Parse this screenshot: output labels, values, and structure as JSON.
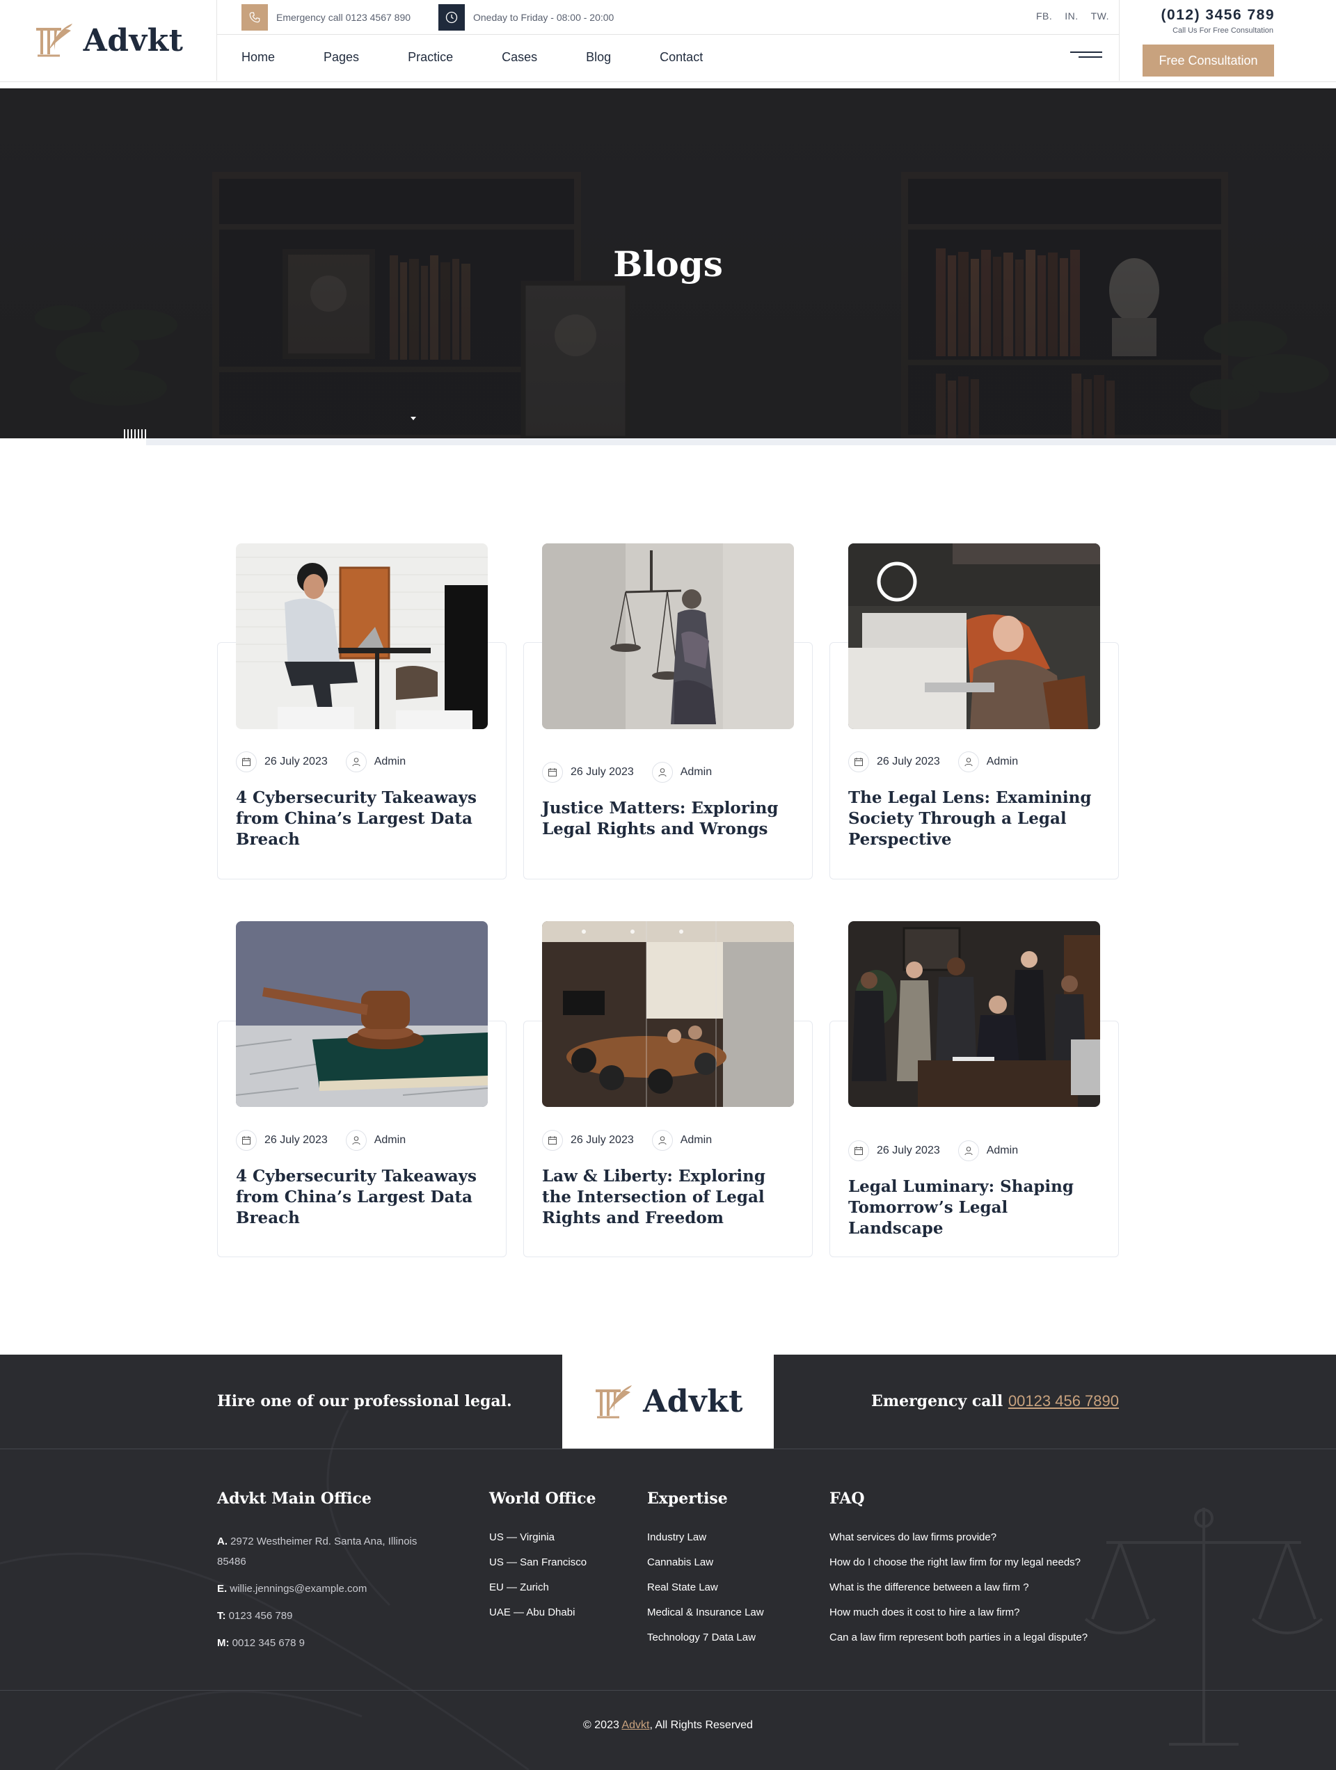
{
  "brand": {
    "name": "Advkt",
    "accent": "#c8a27e",
    "dark": "#1f2a3c"
  },
  "topbar": {
    "emergency": "Emergency call 0123 4567 890",
    "hours": "Oneday to Friday - 08:00 - 20:00",
    "socials": [
      "FB.",
      "IN.",
      "TW."
    ]
  },
  "nav": {
    "items": [
      "Home",
      "Pages",
      "Practice",
      "Cases",
      "Blog",
      "Contact"
    ]
  },
  "contact": {
    "phone": "(012) 3456 789",
    "subtext": "Call Us For Free Consultation",
    "cta": "Free Consultation"
  },
  "hero": {
    "title": "Blogs"
  },
  "posts": [
    {
      "date": "26 July 2023",
      "author": "Admin",
      "title": "4 Cybersecurity Takeaways from China’s Largest Data Breach",
      "image": "person-on-laptop"
    },
    {
      "date": "26 July 2023",
      "author": "Admin",
      "title": "Justice Matters: Exploring Legal Rights and Wrongs",
      "image": "lady-justice-statue"
    },
    {
      "date": "26 July 2023",
      "author": "Admin",
      "title": "The Legal Lens: Examining Society Through a Legal Perspective",
      "image": "woman-in-cafe"
    },
    {
      "date": "26 July 2023",
      "author": "Admin",
      "title": "4 Cybersecurity Takeaways from China’s Largest Data Breach",
      "image": "gavel-on-book"
    },
    {
      "date": "26 July 2023",
      "author": "Admin",
      "title": "Law & Liberty: Exploring the Intersection of Legal Rights and Freedom",
      "image": "meeting-room"
    },
    {
      "date": "26 July 2023",
      "author": "Admin",
      "title": "Legal Luminary: Shaping Tomorrow’s Legal Landscape",
      "image": "legal-team"
    }
  ],
  "footer": {
    "hire": "Hire one of our professional legal.",
    "emergency_label": "Emergency call",
    "emergency_number": "00123 456 7890",
    "office": {
      "heading": "Advkt Main Office",
      "address_label": "A.",
      "address": "2972 Westheimer Rd. Santa Ana, Illinois 85486",
      "email_label": "E.",
      "email": "willie.jennings@example.com",
      "tel_label": "T:",
      "tel": "0123 456 789",
      "mobile_label": "M:",
      "mobile": "0012 345 678 9"
    },
    "world": {
      "heading": "World Office",
      "items": [
        "US — Virginia",
        "US — San Francisco",
        "EU — Zurich",
        "UAE — Abu Dhabi"
      ]
    },
    "expertise": {
      "heading": "Expertise",
      "items": [
        "Industry Law",
        "Cannabis Law",
        "Real State Law",
        "Medical & Insurance Law",
        "Technology 7 Data Law"
      ]
    },
    "faq": {
      "heading": "FAQ",
      "items": [
        "What services do law firms provide?",
        "How do I choose the right law firm for my legal needs?",
        "What is the difference between a law firm ?",
        "How much does it cost to hire a law firm?",
        "Can a law firm represent both parties in a legal dispute?"
      ]
    },
    "copyright_prefix": "© 2023 ",
    "copyright_brand": "Advkt",
    "copyright_suffix": ", All Rights Reserved"
  }
}
